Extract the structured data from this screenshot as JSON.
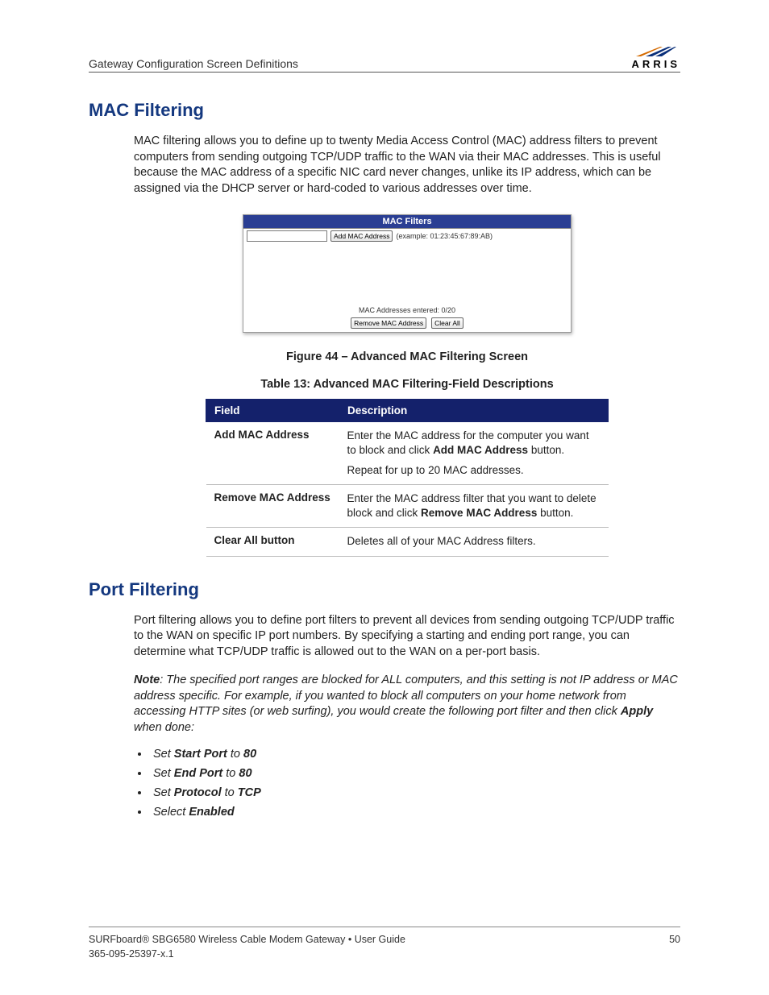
{
  "header": {
    "breadcrumb": "Gateway Configuration Screen Definitions",
    "logo_text": "ARRIS"
  },
  "section1": {
    "heading": "MAC Filtering",
    "para": "MAC filtering allows you to define up to twenty Media Access Control (MAC) address filters to prevent computers from sending outgoing TCP/UDP traffic to the WAN via their MAC addresses. This is useful because the MAC address of a specific NIC card never changes, unlike its IP address, which can be assigned via the DHCP server or hard-coded to various addresses over time."
  },
  "mac_panel": {
    "title": "MAC Filters",
    "add_btn": "Add MAC Address",
    "example_text": "(example: 01:23:45:67:89:AB)",
    "status": "MAC Addresses entered: 0/20",
    "remove_btn": "Remove MAC Address",
    "clear_btn": "Clear All"
  },
  "figure_caption": "Figure 44 – Advanced MAC Filtering Screen",
  "table_caption": "Table 13: Advanced MAC Filtering-Field Descriptions",
  "table": {
    "h1": "Field",
    "h2": "Description",
    "rows": [
      {
        "field": "Add MAC  Address",
        "d1a": "Enter the MAC address for the computer you want to block and click ",
        "d1b": "Add MAC Address",
        "d1c": " button.",
        "d2": "Repeat for up to 20 MAC addresses."
      },
      {
        "field": "Remove MAC Address",
        "d1a": "Enter the MAC address filter that you want to delete block and click ",
        "d1b": "Remove MAC Address",
        "d1c": " button."
      },
      {
        "field": "Clear All button",
        "d1": "Deletes all of your MAC Address filters."
      }
    ]
  },
  "section2": {
    "heading": "Port Filtering",
    "para": "Port filtering allows you to define port filters to prevent all devices from sending outgoing TCP/UDP traffic to the WAN on specific IP port numbers. By specifying a starting and ending port range, you can determine what TCP/UDP traffic is allowed out to the WAN on a per-port basis.",
    "note_lead": "Note",
    "note_body": ": The specified port ranges are blocked for ALL computers, and this setting is not IP address or MAC address specific. For example, if you wanted to block all computers on your home network from accessing HTTP sites (or web surfing), you would create the following port filter and then click ",
    "note_bold": "Apply",
    "note_tail": " when done:",
    "bullets": [
      {
        "pre": "Set ",
        "b": "Start Port",
        "mid": " to ",
        "b2": "80"
      },
      {
        "pre": "Set ",
        "b": "End Port",
        "mid": " to ",
        "b2": "80"
      },
      {
        "pre": "Set ",
        "b": "Protocol",
        "mid": " to ",
        "b2": "TCP"
      },
      {
        "pre": "Select ",
        "b": "Enabled",
        "mid": "",
        "b2": ""
      }
    ]
  },
  "footer": {
    "line1_left": "SURFboard® SBG6580 Wireless Cable Modem Gateway • User Guide",
    "page_number": "50",
    "line2": "365-095-25397-x.1"
  }
}
